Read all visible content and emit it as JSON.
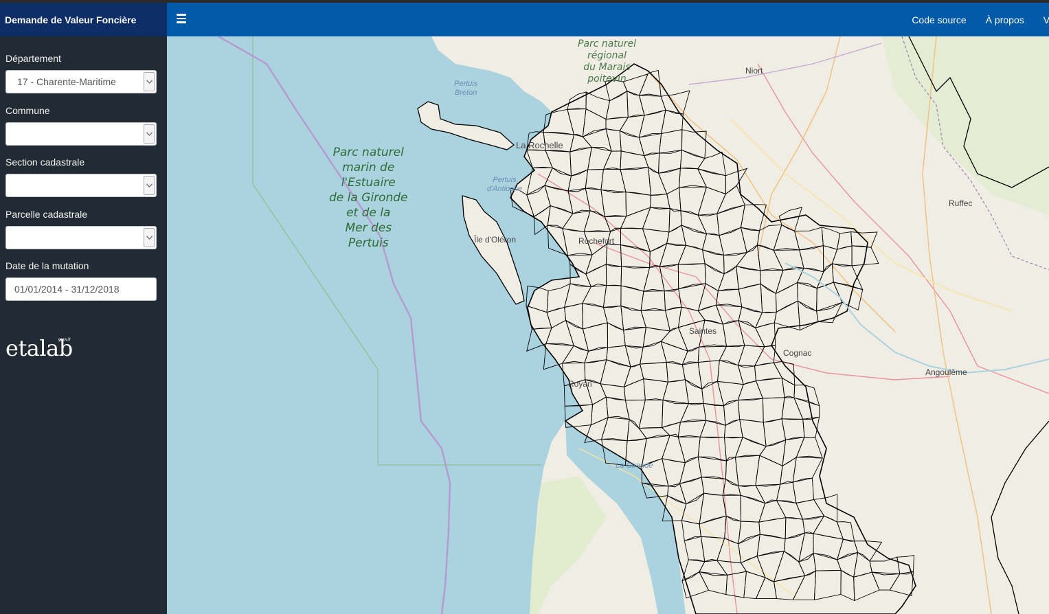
{
  "app": {
    "title": "Demande de Valeur Foncière"
  },
  "navbar": {
    "menu_icon": "hamburger-icon",
    "links": [
      "Code source",
      "À propos",
      "Vot"
    ]
  },
  "form": {
    "departement_label": "Département",
    "departement_value": "17 - Charente-Maritime",
    "commune_label": "Commune",
    "commune_value": "",
    "section_label": "Section cadastrale",
    "section_value": "",
    "parcelle_label": "Parcelle cadastrale",
    "parcelle_value": "",
    "date_label": "Date de la mutation",
    "date_value": "01/01/2014 - 31/12/2018"
  },
  "logo": {
    "text": "etalab",
    "suffix": "gouv.fr"
  },
  "map": {
    "sea_color": "#aad3df",
    "land_color": "#f2efe6",
    "boundary_color": "#000000",
    "park_label": "Parc naturel marin de l'Estuaire de la Gironde et de la Mer des Pertuis",
    "park_label_lines": [
      "Parc naturel",
      "marin de",
      "l'Estuaire",
      "de la Gironde",
      "et de la",
      "Mer des",
      "Pertuis"
    ],
    "park2_lines": [
      "Parc naturel",
      "régional",
      "du Marais",
      "poitevin"
    ],
    "sea_labels": {
      "pertuis_breton": [
        "Pertuis",
        "Breton"
      ],
      "pertuis_antioche": [
        "Pertuis",
        "d'Antioche"
      ],
      "gironde": "La Gironde"
    },
    "places": {
      "niort": "Niort",
      "la_rochelle": "La Rochelle",
      "ile_oleron": "Île d'Oléron",
      "rochefort": "Rochefort",
      "ruffec": "Ruffec",
      "saintes": "Saintes",
      "cognac": "Cognac",
      "angouleme": "Angoulême",
      "royan": "Royan"
    }
  }
}
